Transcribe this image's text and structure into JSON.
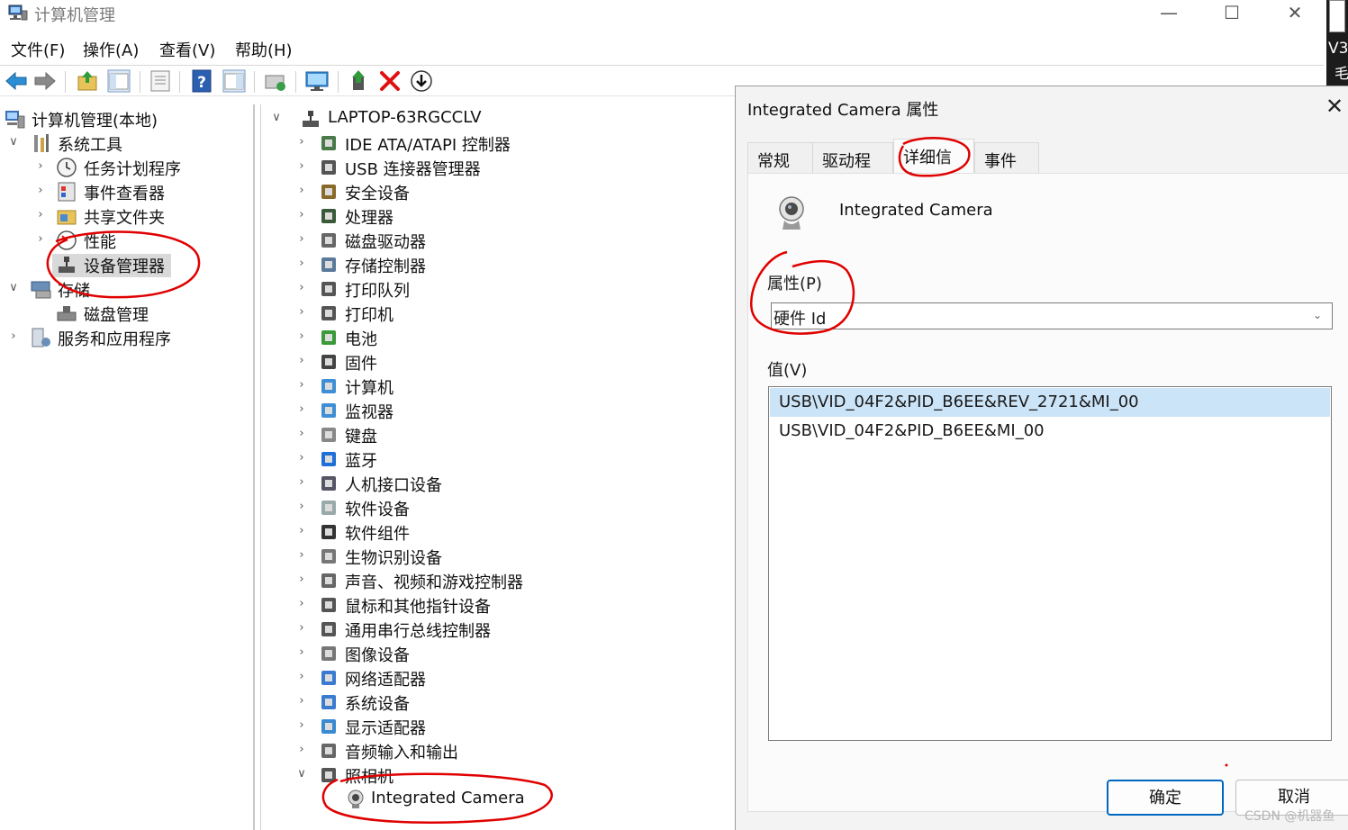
{
  "window": {
    "title": "计算机管理",
    "minimize_glyph": "—",
    "maximize_glyph": "☐",
    "close_glyph": "✕"
  },
  "side_strip": {
    "text1": "V3",
    "text2": "毛"
  },
  "menu": [
    {
      "label": "文件(F)"
    },
    {
      "label": "操作(A)"
    },
    {
      "label": "查看(V)"
    },
    {
      "label": "帮助(H)"
    }
  ],
  "toolbar": {
    "items": [
      "back-icon",
      "forward-icon",
      "up-folder-icon",
      "show-hide-tree-icon",
      "properties-icon",
      "help-icon",
      "action-pane-icon",
      "scan-hardware-icon",
      "monitor-icon",
      "update-driver-icon",
      "uninstall-icon",
      "disable-device-icon"
    ]
  },
  "left_tree": [
    {
      "label": "计算机管理(本地)",
      "icon": "computer-management-icon",
      "chevron": ""
    },
    {
      "label": "系统工具",
      "icon": "system-tools-icon",
      "chevron": "∨"
    },
    {
      "label": "任务计划程序",
      "icon": "task-scheduler-icon",
      "chevron": "›"
    },
    {
      "label": "事件查看器",
      "icon": "event-viewer-icon",
      "chevron": "›"
    },
    {
      "label": "共享文件夹",
      "icon": "shared-folders-icon",
      "chevron": "›"
    },
    {
      "label": "性能",
      "icon": "performance-icon",
      "chevron": "›"
    },
    {
      "label": "设备管理器",
      "icon": "device-manager-icon",
      "chevron": ""
    },
    {
      "label": "存储",
      "icon": "storage-icon",
      "chevron": "∨"
    },
    {
      "label": "磁盘管理",
      "icon": "disk-management-icon",
      "chevron": ""
    },
    {
      "label": "服务和应用程序",
      "icon": "services-apps-icon",
      "chevron": "›"
    }
  ],
  "device_tree": {
    "root": "LAPTOP-63RGCCLV",
    "categories": [
      {
        "label": "IDE ATA/ATAPI 控制器",
        "icon": "ide-controller-icon"
      },
      {
        "label": "USB 连接器管理器",
        "icon": "usb-connector-icon"
      },
      {
        "label": "安全设备",
        "icon": "security-device-icon"
      },
      {
        "label": "处理器",
        "icon": "processor-icon"
      },
      {
        "label": "磁盘驱动器",
        "icon": "disk-drive-icon"
      },
      {
        "label": "存储控制器",
        "icon": "storage-controller-icon"
      },
      {
        "label": "打印队列",
        "icon": "print-queue-icon"
      },
      {
        "label": "打印机",
        "icon": "printer-icon"
      },
      {
        "label": "电池",
        "icon": "battery-icon"
      },
      {
        "label": "固件",
        "icon": "firmware-icon"
      },
      {
        "label": "计算机",
        "icon": "computer-icon"
      },
      {
        "label": "监视器",
        "icon": "monitor-icon"
      },
      {
        "label": "键盘",
        "icon": "keyboard-icon"
      },
      {
        "label": "蓝牙",
        "icon": "bluetooth-icon"
      },
      {
        "label": "人机接口设备",
        "icon": "hid-icon"
      },
      {
        "label": "软件设备",
        "icon": "software-device-icon"
      },
      {
        "label": "软件组件",
        "icon": "software-component-icon"
      },
      {
        "label": "生物识别设备",
        "icon": "biometric-icon"
      },
      {
        "label": "声音、视频和游戏控制器",
        "icon": "sound-icon"
      },
      {
        "label": "鼠标和其他指针设备",
        "icon": "mouse-icon"
      },
      {
        "label": "通用串行总线控制器",
        "icon": "usb-controller-icon"
      },
      {
        "label": "图像设备",
        "icon": "imaging-device-icon"
      },
      {
        "label": "网络适配器",
        "icon": "network-adapter-icon"
      },
      {
        "label": "系统设备",
        "icon": "system-device-icon"
      },
      {
        "label": "显示适配器",
        "icon": "display-adapter-icon"
      },
      {
        "label": "音频输入和输出",
        "icon": "audio-io-icon"
      },
      {
        "label": "照相机",
        "icon": "camera-icon",
        "expanded": true
      }
    ],
    "camera_child": "Integrated Camera"
  },
  "dialog": {
    "title": "Integrated Camera 属性",
    "close_glyph": "✕",
    "tabs": [
      {
        "label": "常规"
      },
      {
        "label": "驱动程序"
      },
      {
        "label": "详细信息",
        "active": true
      },
      {
        "label": "事件"
      }
    ],
    "device_name": "Integrated Camera",
    "property_label": "属性(P)",
    "property_value": "硬件 Id",
    "value_label": "值(V)",
    "values": [
      "USB\\VID_04F2&PID_B6EE&REV_2721&MI_00",
      "USB\\VID_04F2&PID_B6EE&MI_00"
    ],
    "ok": "确定",
    "cancel": "取消"
  },
  "watermark": "CSDN @机器鱼",
  "colors": {
    "selection": "#cce4f7",
    "accent": "#0067c0",
    "annotation": "#e00000",
    "tree_selected": "#d9d9d9"
  }
}
